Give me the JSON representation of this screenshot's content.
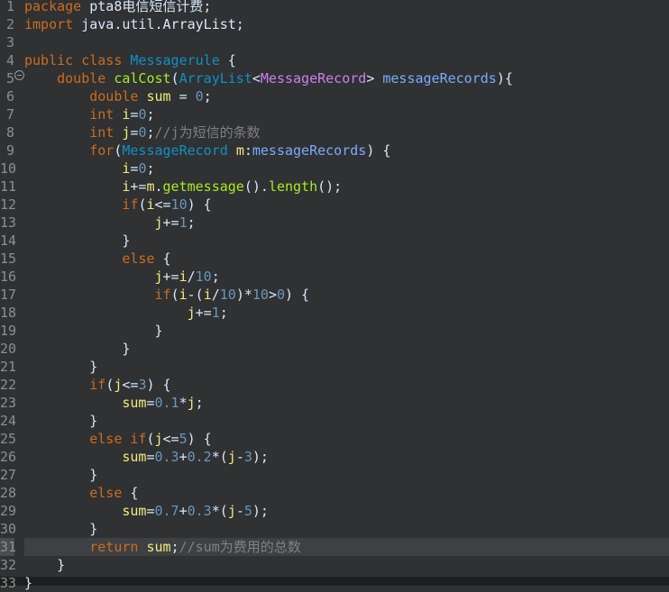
{
  "colors": {
    "background": "#2f3133",
    "current_line": "#3e4043",
    "keyword": "#cc6c1d",
    "class_name": "#1290c3",
    "method": "#a7ec21",
    "type_param": "#cd80ee",
    "parameter": "#79abff",
    "local_var": "#f3ec79",
    "number": "#6897bb",
    "comment": "#808080",
    "plain": "#d9e8f7"
  },
  "editor": {
    "highlighted_line": 31,
    "lines": [
      {
        "n": "1",
        "tokens": [
          {
            "t": "package",
            "c": "kw"
          },
          {
            "t": " pta8电信短信计费;",
            "c": "pl"
          }
        ]
      },
      {
        "n": "2",
        "tokens": [
          {
            "t": "import",
            "c": "kw"
          },
          {
            "t": " java.util.ArrayList;",
            "c": "pl"
          }
        ]
      },
      {
        "n": "3",
        "tokens": []
      },
      {
        "n": "4",
        "tokens": [
          {
            "t": "public",
            "c": "kw"
          },
          {
            "t": " ",
            "c": "pl"
          },
          {
            "t": "class",
            "c": "kw"
          },
          {
            "t": " ",
            "c": "pl"
          },
          {
            "t": "Messagerule",
            "c": "cl"
          },
          {
            "t": " {",
            "c": "pl"
          }
        ]
      },
      {
        "n": "5",
        "tokens": [
          {
            "t": "    ",
            "c": "pl"
          },
          {
            "t": "double",
            "c": "kw"
          },
          {
            "t": " ",
            "c": "pl"
          },
          {
            "t": "calCost",
            "c": "fn"
          },
          {
            "t": "(",
            "c": "pl"
          },
          {
            "t": "ArrayList",
            "c": "cl"
          },
          {
            "t": "<",
            "c": "pl"
          },
          {
            "t": "MessageRecord",
            "c": "ty"
          },
          {
            "t": "> ",
            "c": "pl"
          },
          {
            "t": "messageRecords",
            "c": "pa"
          },
          {
            "t": "){",
            "c": "pl"
          }
        ]
      },
      {
        "n": "6",
        "tokens": [
          {
            "t": "        ",
            "c": "pl"
          },
          {
            "t": "double",
            "c": "kw"
          },
          {
            "t": " ",
            "c": "pl"
          },
          {
            "t": "sum",
            "c": "lo"
          },
          {
            "t": " = ",
            "c": "pl"
          },
          {
            "t": "0",
            "c": "nm"
          },
          {
            "t": ";",
            "c": "pl"
          }
        ]
      },
      {
        "n": "7",
        "tokens": [
          {
            "t": "        ",
            "c": "pl"
          },
          {
            "t": "int",
            "c": "kw"
          },
          {
            "t": " ",
            "c": "pl"
          },
          {
            "t": "i",
            "c": "lo"
          },
          {
            "t": "=",
            "c": "pl"
          },
          {
            "t": "0",
            "c": "nm"
          },
          {
            "t": ";",
            "c": "pl"
          }
        ]
      },
      {
        "n": "8",
        "tokens": [
          {
            "t": "        ",
            "c": "pl"
          },
          {
            "t": "int",
            "c": "kw"
          },
          {
            "t": " ",
            "c": "pl"
          },
          {
            "t": "j",
            "c": "lo"
          },
          {
            "t": "=",
            "c": "pl"
          },
          {
            "t": "0",
            "c": "nm"
          },
          {
            "t": ";",
            "c": "pl"
          },
          {
            "t": "//j为短信的条数",
            "c": "cm"
          }
        ]
      },
      {
        "n": "9",
        "tokens": [
          {
            "t": "        ",
            "c": "pl"
          },
          {
            "t": "for",
            "c": "kw"
          },
          {
            "t": "(",
            "c": "pl"
          },
          {
            "t": "MessageRecord",
            "c": "cl"
          },
          {
            "t": " ",
            "c": "pl"
          },
          {
            "t": "m",
            "c": "lo"
          },
          {
            "t": ":",
            "c": "pl"
          },
          {
            "t": "messageRecords",
            "c": "pa"
          },
          {
            "t": ") {",
            "c": "pl"
          }
        ]
      },
      {
        "n": "10",
        "tokens": [
          {
            "t": "            ",
            "c": "pl"
          },
          {
            "t": "i",
            "c": "lo"
          },
          {
            "t": "=",
            "c": "pl"
          },
          {
            "t": "0",
            "c": "nm"
          },
          {
            "t": ";",
            "c": "pl"
          }
        ]
      },
      {
        "n": "11",
        "tokens": [
          {
            "t": "            ",
            "c": "pl"
          },
          {
            "t": "i",
            "c": "lo"
          },
          {
            "t": "+=",
            "c": "pl"
          },
          {
            "t": "m",
            "c": "lo"
          },
          {
            "t": ".",
            "c": "pl"
          },
          {
            "t": "getmessage",
            "c": "fn"
          },
          {
            "t": "().",
            "c": "pl"
          },
          {
            "t": "length",
            "c": "fn"
          },
          {
            "t": "();",
            "c": "pl"
          }
        ]
      },
      {
        "n": "12",
        "tokens": [
          {
            "t": "            ",
            "c": "pl"
          },
          {
            "t": "if",
            "c": "kw"
          },
          {
            "t": "(",
            "c": "pl"
          },
          {
            "t": "i",
            "c": "lo"
          },
          {
            "t": "<=",
            "c": "pl"
          },
          {
            "t": "10",
            "c": "nm"
          },
          {
            "t": ") {",
            "c": "pl"
          }
        ]
      },
      {
        "n": "13",
        "tokens": [
          {
            "t": "                ",
            "c": "pl"
          },
          {
            "t": "j",
            "c": "lo"
          },
          {
            "t": "+=",
            "c": "pl"
          },
          {
            "t": "1",
            "c": "nm"
          },
          {
            "t": ";",
            "c": "pl"
          }
        ]
      },
      {
        "n": "14",
        "tokens": [
          {
            "t": "            }",
            "c": "pl"
          }
        ]
      },
      {
        "n": "15",
        "tokens": [
          {
            "t": "            ",
            "c": "pl"
          },
          {
            "t": "else",
            "c": "kw"
          },
          {
            "t": " {",
            "c": "pl"
          }
        ]
      },
      {
        "n": "16",
        "tokens": [
          {
            "t": "                ",
            "c": "pl"
          },
          {
            "t": "j",
            "c": "lo"
          },
          {
            "t": "+=",
            "c": "pl"
          },
          {
            "t": "i",
            "c": "lo"
          },
          {
            "t": "/",
            "c": "pl"
          },
          {
            "t": "10",
            "c": "nm"
          },
          {
            "t": ";",
            "c": "pl"
          }
        ]
      },
      {
        "n": "17",
        "tokens": [
          {
            "t": "                ",
            "c": "pl"
          },
          {
            "t": "if",
            "c": "kw"
          },
          {
            "t": "(",
            "c": "pl"
          },
          {
            "t": "i",
            "c": "lo"
          },
          {
            "t": "-(",
            "c": "pl"
          },
          {
            "t": "i",
            "c": "lo"
          },
          {
            "t": "/",
            "c": "pl"
          },
          {
            "t": "10",
            "c": "nm"
          },
          {
            "t": ")*",
            "c": "pl"
          },
          {
            "t": "10",
            "c": "nm"
          },
          {
            "t": ">",
            "c": "pl"
          },
          {
            "t": "0",
            "c": "nm"
          },
          {
            "t": ") {",
            "c": "pl"
          }
        ]
      },
      {
        "n": "18",
        "tokens": [
          {
            "t": "                    ",
            "c": "pl"
          },
          {
            "t": "j",
            "c": "lo"
          },
          {
            "t": "+=",
            "c": "pl"
          },
          {
            "t": "1",
            "c": "nm"
          },
          {
            "t": ";",
            "c": "pl"
          }
        ]
      },
      {
        "n": "19",
        "tokens": [
          {
            "t": "                }",
            "c": "pl"
          }
        ]
      },
      {
        "n": "20",
        "tokens": [
          {
            "t": "            }",
            "c": "pl"
          }
        ]
      },
      {
        "n": "21",
        "tokens": [
          {
            "t": "        }",
            "c": "pl"
          }
        ]
      },
      {
        "n": "22",
        "tokens": [
          {
            "t": "        ",
            "c": "pl"
          },
          {
            "t": "if",
            "c": "kw"
          },
          {
            "t": "(",
            "c": "pl"
          },
          {
            "t": "j",
            "c": "lo"
          },
          {
            "t": "<=",
            "c": "pl"
          },
          {
            "t": "3",
            "c": "nm"
          },
          {
            "t": ") {",
            "c": "pl"
          }
        ]
      },
      {
        "n": "23",
        "tokens": [
          {
            "t": "            ",
            "c": "pl"
          },
          {
            "t": "sum",
            "c": "lo"
          },
          {
            "t": "=",
            "c": "pl"
          },
          {
            "t": "0.1",
            "c": "nm"
          },
          {
            "t": "*",
            "c": "pl"
          },
          {
            "t": "j",
            "c": "lo"
          },
          {
            "t": ";",
            "c": "pl"
          }
        ]
      },
      {
        "n": "24",
        "tokens": [
          {
            "t": "        }",
            "c": "pl"
          }
        ]
      },
      {
        "n": "25",
        "tokens": [
          {
            "t": "        ",
            "c": "pl"
          },
          {
            "t": "else",
            "c": "kw"
          },
          {
            "t": " ",
            "c": "pl"
          },
          {
            "t": "if",
            "c": "kw"
          },
          {
            "t": "(",
            "c": "pl"
          },
          {
            "t": "j",
            "c": "lo"
          },
          {
            "t": "<=",
            "c": "pl"
          },
          {
            "t": "5",
            "c": "nm"
          },
          {
            "t": ") {",
            "c": "pl"
          }
        ]
      },
      {
        "n": "26",
        "tokens": [
          {
            "t": "            ",
            "c": "pl"
          },
          {
            "t": "sum",
            "c": "lo"
          },
          {
            "t": "=",
            "c": "pl"
          },
          {
            "t": "0.3",
            "c": "nm"
          },
          {
            "t": "+",
            "c": "pl"
          },
          {
            "t": "0.2",
            "c": "nm"
          },
          {
            "t": "*(",
            "c": "pl"
          },
          {
            "t": "j",
            "c": "lo"
          },
          {
            "t": "-",
            "c": "pl"
          },
          {
            "t": "3",
            "c": "nm"
          },
          {
            "t": ");",
            "c": "pl"
          }
        ]
      },
      {
        "n": "27",
        "tokens": [
          {
            "t": "        }",
            "c": "pl"
          }
        ]
      },
      {
        "n": "28",
        "tokens": [
          {
            "t": "        ",
            "c": "pl"
          },
          {
            "t": "else",
            "c": "kw"
          },
          {
            "t": " {",
            "c": "pl"
          }
        ]
      },
      {
        "n": "29",
        "tokens": [
          {
            "t": "            ",
            "c": "pl"
          },
          {
            "t": "sum",
            "c": "lo"
          },
          {
            "t": "=",
            "c": "pl"
          },
          {
            "t": "0.7",
            "c": "nm"
          },
          {
            "t": "+",
            "c": "pl"
          },
          {
            "t": "0.3",
            "c": "nm"
          },
          {
            "t": "*(",
            "c": "pl"
          },
          {
            "t": "j",
            "c": "lo"
          },
          {
            "t": "-",
            "c": "pl"
          },
          {
            "t": "5",
            "c": "nm"
          },
          {
            "t": ");",
            "c": "pl"
          }
        ]
      },
      {
        "n": "30",
        "tokens": [
          {
            "t": "        }",
            "c": "pl"
          }
        ]
      },
      {
        "n": "31",
        "tokens": [
          {
            "t": "        ",
            "c": "pl"
          },
          {
            "t": "return",
            "c": "kw"
          },
          {
            "t": " ",
            "c": "pl"
          },
          {
            "t": "sum",
            "c": "lo"
          },
          {
            "t": ";",
            "c": "pl"
          },
          {
            "t": "//sum为费用的总数",
            "c": "cm"
          }
        ]
      },
      {
        "n": "32",
        "tokens": [
          {
            "t": "    }",
            "c": "pl"
          }
        ]
      },
      {
        "n": "33",
        "tokens": [
          {
            "t": "}",
            "c": "pl"
          }
        ]
      }
    ]
  }
}
